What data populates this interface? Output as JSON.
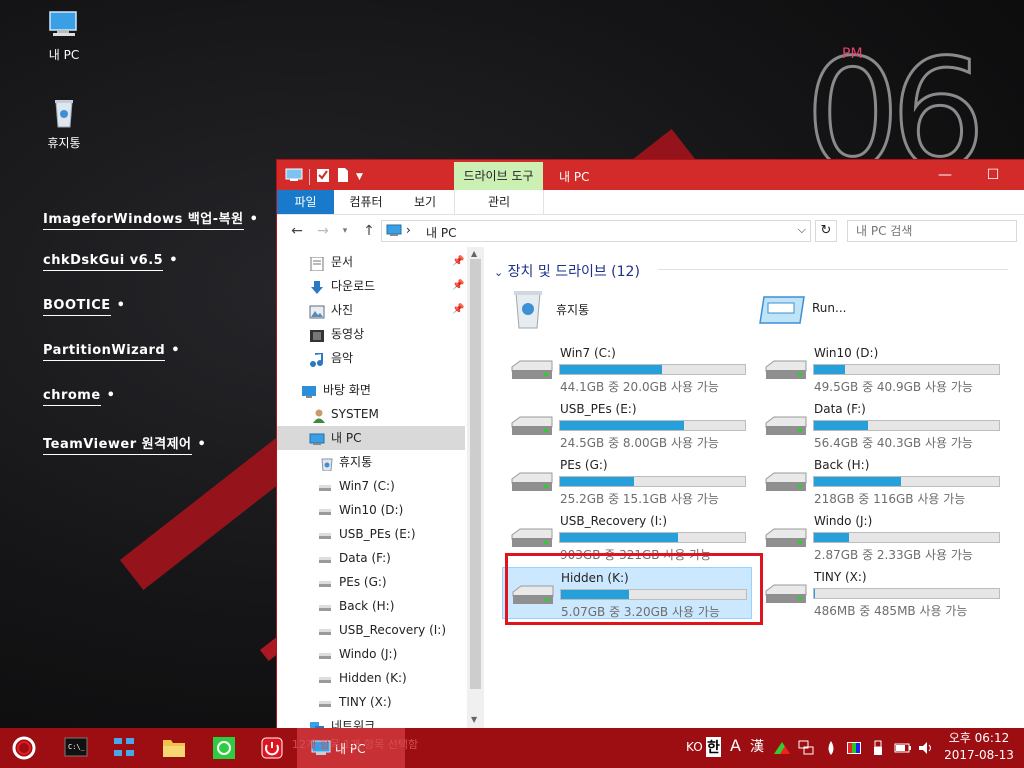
{
  "desktop": {
    "icons": [
      {
        "label": "내 PC"
      },
      {
        "label": "휴지통"
      }
    ],
    "links": [
      {
        "label": "ImageforWindows 백업-복원"
      },
      {
        "label": "chkDskGui v6.5"
      },
      {
        "label": "BOOTICE"
      },
      {
        "label": "PartitionWizard"
      },
      {
        "label": "chrome"
      },
      {
        "label": "TeamViewer 원격제어"
      }
    ],
    "link_suffix": "•",
    "clock_deco": {
      "ampm": "PM",
      "digits": "06"
    }
  },
  "window": {
    "title": "내 PC",
    "context_tab": "드라이브 도구",
    "ribbon_tabs": [
      "파일",
      "컴퓨터",
      "보기",
      "관리"
    ],
    "address": {
      "separator": "›",
      "path": "내 PC"
    },
    "search_placeholder": "내 PC 검색",
    "controls": {
      "minimize": "—",
      "maximize": "☐"
    },
    "nav": {
      "quick_access": [
        {
          "label": "문서",
          "icon": "documents-icon"
        },
        {
          "label": "다운로드",
          "icon": "download-icon"
        },
        {
          "label": "사진",
          "icon": "pictures-icon"
        },
        {
          "label": "동영상",
          "icon": "videos-icon"
        },
        {
          "label": "음악",
          "icon": "music-icon"
        }
      ],
      "roots": [
        {
          "label": "바탕 화면"
        },
        {
          "label": "SYSTEM"
        },
        {
          "label": "내 PC"
        }
      ],
      "pc_children": [
        "휴지통",
        "Win7 (C:)",
        "Win10 (D:)",
        "USB_PEs (E:)",
        "Data (F:)",
        "PEs (G:)",
        "Back (H:)",
        "USB_Recovery (I:)",
        "Windo (J:)",
        "Hidden (K:)",
        "TINY (X:)"
      ],
      "network": "네트워크"
    },
    "group_header": "장치 및 드라이브 (12)",
    "special_items": [
      {
        "name": "휴지통"
      },
      {
        "name": "Run..."
      }
    ],
    "drives": [
      {
        "name": "Win7 (C:)",
        "info": "44.1GB 중 20.0GB 사용 가능",
        "used": 0.55
      },
      {
        "name": "Win10 (D:)",
        "info": "49.5GB 중 40.9GB 사용 가능",
        "used": 0.17
      },
      {
        "name": "USB_PEs (E:)",
        "info": "24.5GB 중 8.00GB 사용 가능",
        "used": 0.67
      },
      {
        "name": "Data (F:)",
        "info": "56.4GB 중 40.3GB 사용 가능",
        "used": 0.29
      },
      {
        "name": "PEs (G:)",
        "info": "25.2GB 중 15.1GB 사용 가능",
        "used": 0.4
      },
      {
        "name": "Back (H:)",
        "info": "218GB 중 116GB 사용 가능",
        "used": 0.47
      },
      {
        "name": "USB_Recovery (I:)",
        "info": "903GB 중 321GB 사용 가능",
        "used": 0.64
      },
      {
        "name": "Windo (J:)",
        "info": "2.87GB 중 2.33GB 사용 가능",
        "used": 0.19
      },
      {
        "name": "Hidden (K:)",
        "info": "5.07GB 중 3.20GB 사용 가능",
        "used": 0.37
      },
      {
        "name": "TINY (X:)",
        "info": "486MB 중 485MB 사용 가능",
        "used": 0.002
      }
    ]
  },
  "taskbar": {
    "active_app": "내 PC",
    "ghost_status": "12개 항목   1개 항목 선택함",
    "tray": {
      "lang": "KO",
      "ime": "한",
      "mode": "A",
      "hanja": "漢"
    },
    "clock": {
      "time": "오후 06:12",
      "date": "2017-08-13"
    }
  },
  "colors": {
    "title_red": "#d32a2a",
    "taskbar_red": "#9c0e12",
    "accent_blue": "#1979ca",
    "drive_fill": "#26a0da",
    "selection": "#cce8ff",
    "highlight_box": "#e0141e"
  }
}
